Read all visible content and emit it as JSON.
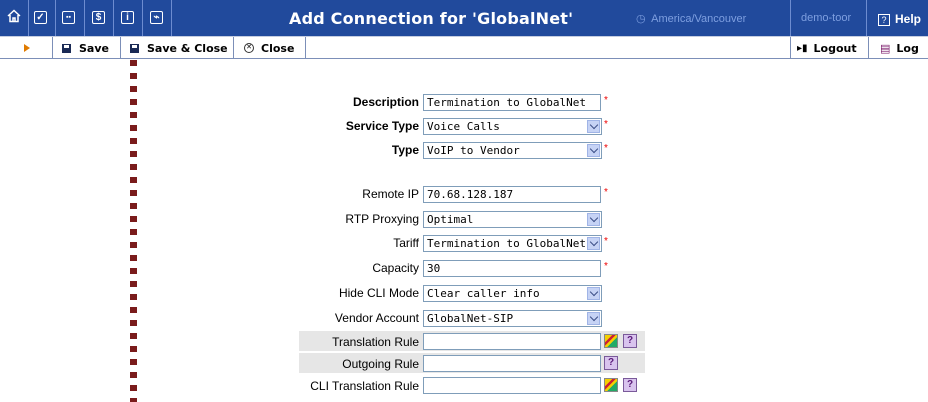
{
  "header": {
    "title": "Add Connection for 'GlobalNet'",
    "timezone": "America/Vancouver",
    "user": "demo-toor",
    "help_label": "Help",
    "colors": {
      "bar": "#214a9c",
      "muted_text": "#7e9fe0"
    }
  },
  "toolbar": {
    "save_label": "Save",
    "save_close_label": "Save & Close",
    "close_label": "Close",
    "logout_label": "Logout",
    "log_label": "Log"
  },
  "form": {
    "description": {
      "label": "Description",
      "value": "Termination to GlobalNet"
    },
    "service_type": {
      "label": "Service Type",
      "value": "Voice Calls"
    },
    "type": {
      "label": "Type",
      "value": "VoIP to Vendor"
    },
    "remote_ip": {
      "label": "Remote IP",
      "value": "70.68.128.187"
    },
    "rtp_proxying": {
      "label": "RTP Proxying",
      "value": "Optimal"
    },
    "tariff": {
      "label": "Tariff",
      "value": "Termination to GlobalNet"
    },
    "capacity": {
      "label": "Capacity",
      "value": "30"
    },
    "hide_cli_mode": {
      "label": "Hide CLI Mode",
      "value": "Clear caller info"
    },
    "vendor_account": {
      "label": "Vendor Account",
      "value": "GlobalNet-SIP"
    },
    "translation_rule": {
      "label": "Translation Rule",
      "value": ""
    },
    "outgoing_rule": {
      "label": "Outgoing Rule",
      "value": ""
    },
    "cli_translation_rule": {
      "label": "CLI Translation Rule",
      "value": ""
    },
    "required_mark": "*"
  }
}
